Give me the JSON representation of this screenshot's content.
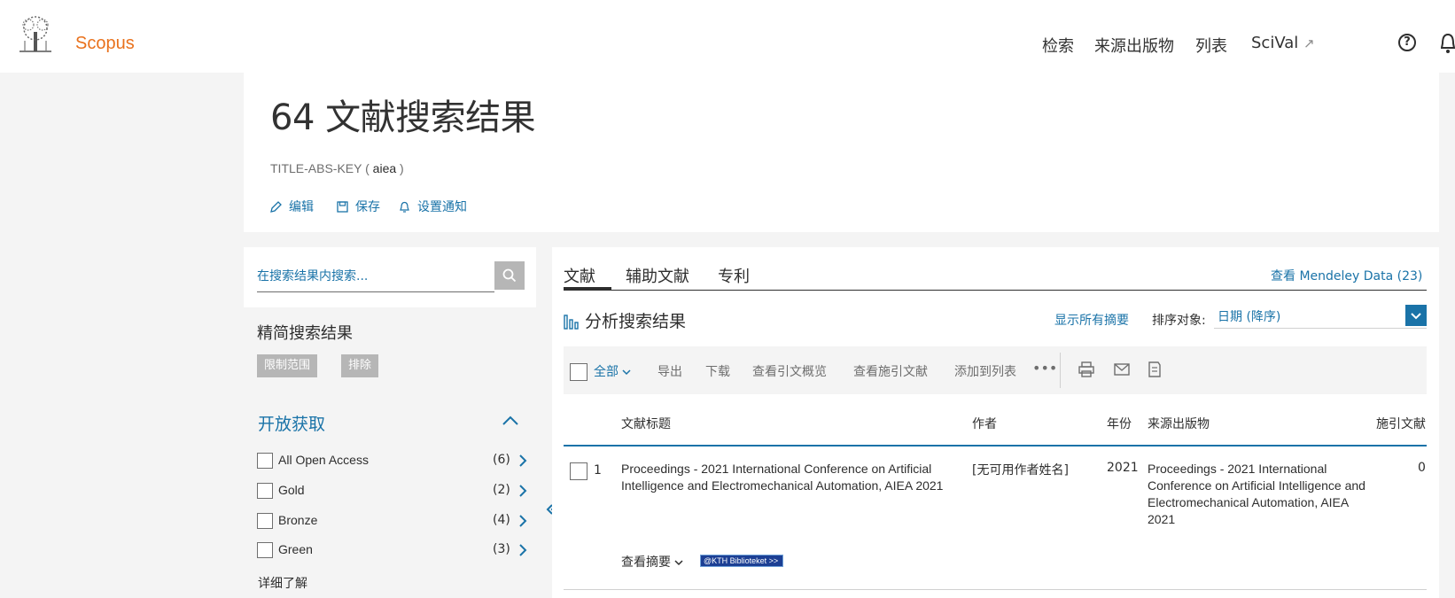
{
  "header": {
    "brand": "Scopus",
    "nav": {
      "search": "检索",
      "sources": "来源出版物",
      "lists": "列表",
      "scival": "SciVal",
      "scival_arrow": "↗"
    },
    "help_icon": "question-circle-icon",
    "help_glyph": "?",
    "bell_icon": "bell-icon"
  },
  "results": {
    "title": "64 文献搜索结果",
    "query_field": "TITLE-ABS-KEY (",
    "query_term": "aiea",
    "query_close": ")",
    "actions": {
      "edit": "编辑",
      "save": "保存",
      "alert": "设置通知"
    }
  },
  "refine": {
    "search_placeholder": "在搜索结果内搜索...",
    "title": "精简搜索结果",
    "limit": "限制范围",
    "exclude": "排除",
    "open_access": {
      "title": "开放获取",
      "items": [
        {
          "label": "All Open Access",
          "count": "(6)"
        },
        {
          "label": "Gold",
          "count": "(2)"
        },
        {
          "label": "Bronze",
          "count": "(4)"
        },
        {
          "label": "Green",
          "count": "(3)"
        }
      ]
    },
    "learn_more": "详细了解"
  },
  "main": {
    "tabs": [
      "文献",
      "辅助文献",
      "专利"
    ],
    "mendeley": "查看 Mendeley Data (23)",
    "analyze": "分析搜索结果",
    "show_abstracts": "显示所有摘要",
    "sort_label": "排序对象:",
    "sort_value": "日期 (降序)",
    "toolbar": {
      "all": "全部",
      "export": "导出",
      "download": "下载",
      "citation_overview": "查看引文概览",
      "cited_by": "查看施引文献",
      "add_to_list": "添加到列表",
      "more": "•••"
    },
    "columns": {
      "title": "文献标题",
      "authors": "作者",
      "year": "年份",
      "source": "来源出版物",
      "cited": "施引文献"
    },
    "rows": [
      {
        "num": "1",
        "title": "Proceedings - 2021 International Conference on Artificial Intelligence and Electromechanical Automation, AIEA 2021",
        "authors": "[无可用作者姓名]",
        "year": "2021",
        "source": "Proceedings - 2021 International Conference on Artificial Intelligence and Electromechanical Automation, AIEA 2021",
        "cited": "0",
        "view_abstract": "查看摘要",
        "kth": "@KTH Biblioteket >>"
      }
    ]
  },
  "colors": {
    "brand": "#e9711c",
    "link": "#1a73a8",
    "muted_chip": "#b6b6b6"
  }
}
